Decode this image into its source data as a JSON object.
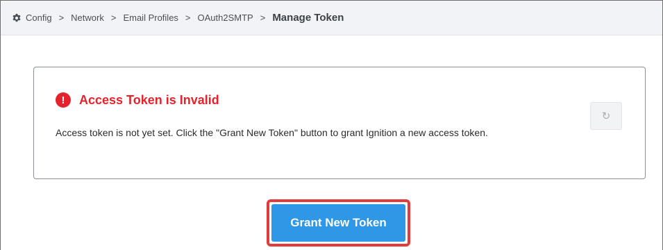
{
  "breadcrumb": {
    "items": [
      "Config",
      "Network",
      "Email Profiles",
      "OAuth2SMTP"
    ],
    "current": "Manage Token",
    "separator": ">"
  },
  "status": {
    "icon": "alert-circle-icon",
    "title": "Access Token is Invalid",
    "message": "Access token is not yet set. Click the \"Grant New Token\" button to grant Ignition a new access token.",
    "color": "#e4242c"
  },
  "actions": {
    "refresh_icon": "refresh-icon",
    "grant_label": "Grant New Token",
    "grant_color": "#2e97e6",
    "highlight_color": "#e23b3b"
  }
}
